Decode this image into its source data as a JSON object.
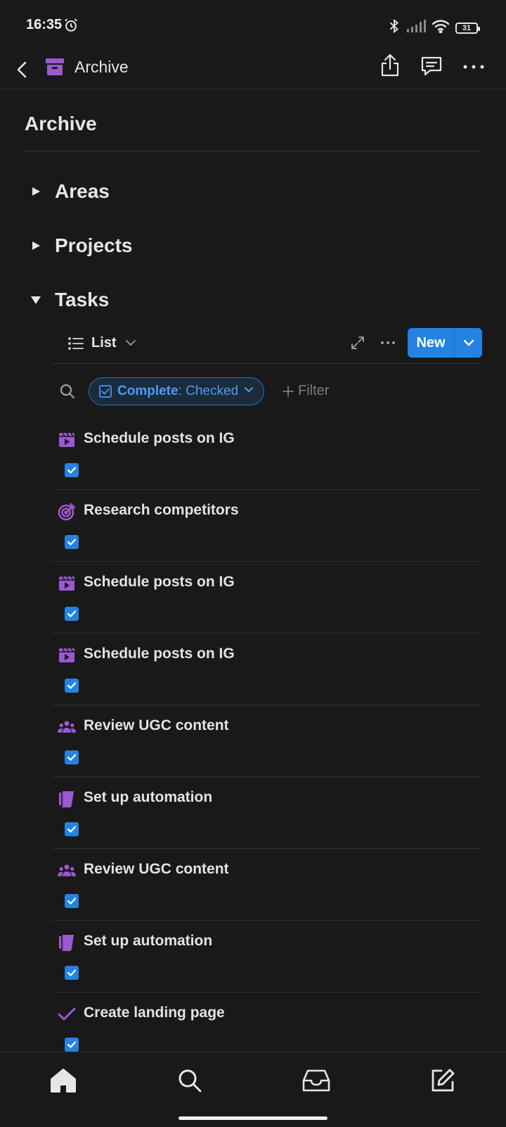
{
  "status_bar": {
    "time": "16:35",
    "battery": "31"
  },
  "header": {
    "title": "Archive"
  },
  "page": {
    "title": "Archive"
  },
  "sections": [
    {
      "label": "Areas",
      "expanded": false
    },
    {
      "label": "Projects",
      "expanded": false
    },
    {
      "label": "Tasks",
      "expanded": true
    }
  ],
  "view": {
    "label": "List",
    "new_label": "New"
  },
  "filter": {
    "property": "Complete",
    "separator": ": ",
    "value": "Checked",
    "add_label": "Filter"
  },
  "tasks": [
    {
      "name": "Schedule posts on IG",
      "icon": "video-icon",
      "checked": true
    },
    {
      "name": "Research competitors",
      "icon": "target-icon",
      "checked": true
    },
    {
      "name": "Schedule posts on IG",
      "icon": "video-icon",
      "checked": true
    },
    {
      "name": "Schedule posts on IG",
      "icon": "video-icon",
      "checked": true
    },
    {
      "name": "Review UGC content",
      "icon": "people-icon",
      "checked": true
    },
    {
      "name": "Set up automation",
      "icon": "scroll-icon",
      "checked": true
    },
    {
      "name": "Review UGC content",
      "icon": "people-icon",
      "checked": true
    },
    {
      "name": "Set up automation",
      "icon": "scroll-icon",
      "checked": true
    },
    {
      "name": "Create landing page",
      "icon": "checkmark-icon",
      "checked": true
    }
  ],
  "colors": {
    "accent": "#2383e2",
    "icon_purple": "#9b59d0",
    "background": "#191919"
  }
}
